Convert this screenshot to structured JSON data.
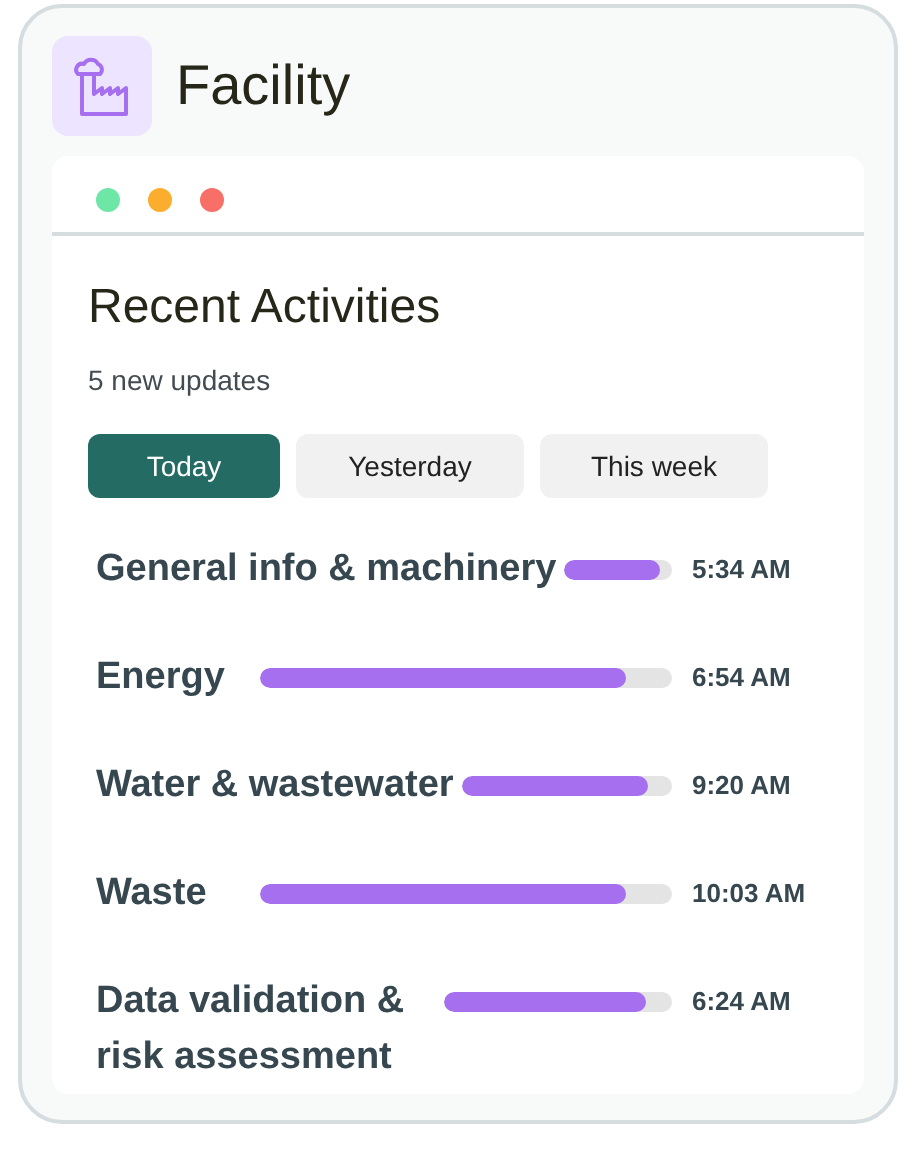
{
  "header": {
    "title": "Facility"
  },
  "panel": {
    "title": "Recent Activities",
    "subtitle": "5 new updates",
    "tabs": [
      {
        "label": "Today",
        "selected": true
      },
      {
        "label": "Yesterday",
        "selected": false
      },
      {
        "label": "This week",
        "selected": false
      }
    ],
    "activities": [
      {
        "name": "General info & machinery",
        "level": 0.89,
        "time": "5:34 AM"
      },
      {
        "name": "Energy",
        "level": 0.89,
        "time": "6:54 AM"
      },
      {
        "name": "Water & wastewater",
        "level": 0.89,
        "time": "9:20 AM"
      },
      {
        "name": "Waste",
        "level": 0.89,
        "time": "10:03 AM"
      },
      {
        "name": "Data validation & risk assessment",
        "level": 0.89,
        "time": "6:24 AM"
      }
    ]
  }
}
